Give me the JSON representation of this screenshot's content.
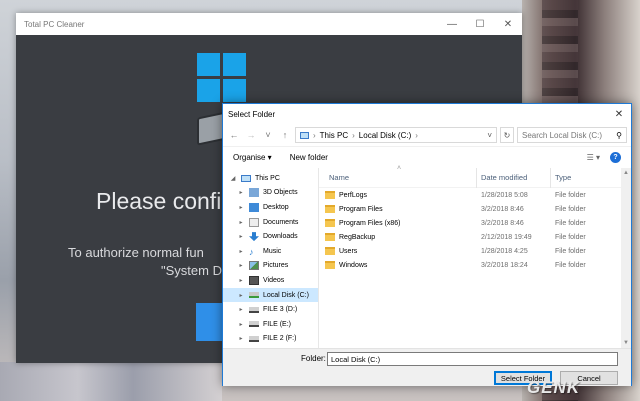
{
  "app": {
    "title": "Total PC Cleaner",
    "heading": "Please confi",
    "subtext_line1": "To authorize normal fun",
    "subtext_line2": "\"System D"
  },
  "dialog": {
    "title": "Select Folder",
    "breadcrumb": [
      "This PC",
      "Local Disk (C:)"
    ],
    "search_placeholder": "Search Local Disk (C:)",
    "toolbar": {
      "organise": "Organise ▾",
      "new_folder": "New folder"
    },
    "nav_tree": [
      {
        "label": "This PC",
        "icon": "computer-icon",
        "expanded": true
      },
      {
        "label": "3D Objects",
        "icon": "3d-objects-icon"
      },
      {
        "label": "Desktop",
        "icon": "desktop-icon"
      },
      {
        "label": "Documents",
        "icon": "documents-icon"
      },
      {
        "label": "Downloads",
        "icon": "downloads-icon"
      },
      {
        "label": "Music",
        "icon": "music-icon"
      },
      {
        "label": "Pictures",
        "icon": "pictures-icon"
      },
      {
        "label": "Videos",
        "icon": "videos-icon"
      },
      {
        "label": "Local Disk (C:)",
        "icon": "drive-icon",
        "selected": true
      },
      {
        "label": "FILE 3 (D:)",
        "icon": "drive-icon"
      },
      {
        "label": "FILE (E:)",
        "icon": "drive-icon"
      },
      {
        "label": "FILE 2 (F:)",
        "icon": "drive-icon"
      }
    ],
    "columns": {
      "name": "Name",
      "date": "Date modified",
      "type": "Type"
    },
    "files": [
      {
        "name": "PerfLogs",
        "date": "1/28/2018 5:08",
        "type": "File folder"
      },
      {
        "name": "Program Files",
        "date": "3/2/2018 8:46",
        "type": "File folder"
      },
      {
        "name": "Program Files (x86)",
        "date": "3/2/2018 8:46",
        "type": "File folder"
      },
      {
        "name": "RegBackup",
        "date": "2/12/2018 19:49",
        "type": "File folder"
      },
      {
        "name": "Users",
        "date": "1/28/2018 4:25",
        "type": "File folder"
      },
      {
        "name": "Windows",
        "date": "3/2/2018 18:24",
        "type": "File folder"
      }
    ],
    "folder_label": "Folder:",
    "folder_value": "Local Disk (C:)",
    "select_button": "Select Folder",
    "cancel_button": "Cancel"
  },
  "watermark": "GENK",
  "colors": {
    "accent": "#0078d7",
    "app_bg": "#3a3d42",
    "selected": "#cce8ff",
    "folder": "#f5c64f"
  }
}
